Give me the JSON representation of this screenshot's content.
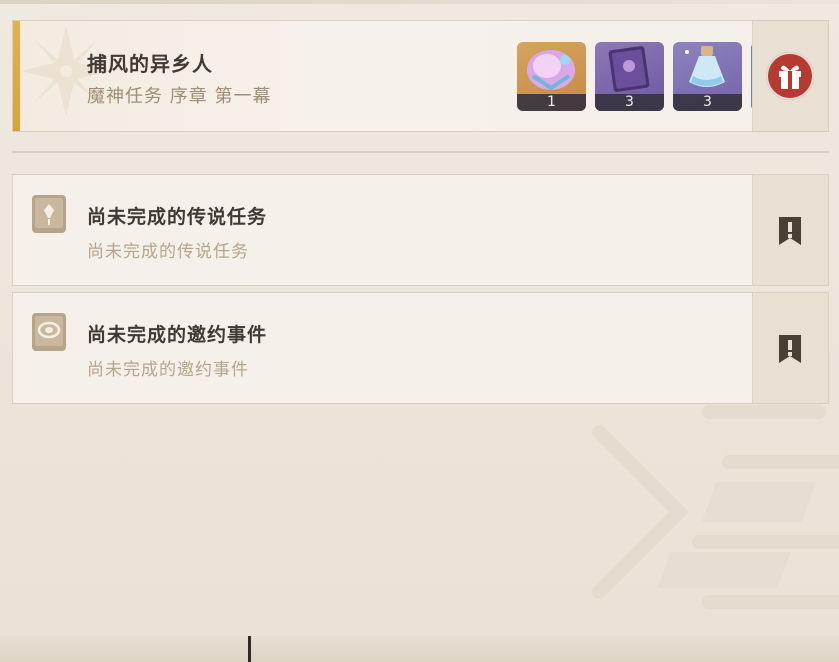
{
  "main_quest": {
    "title": "捕风的异乡人",
    "subtitle": "魔神任务 序章 第一幕",
    "accent_color": "#e2b14a",
    "rewards": [
      {
        "icon": "crystal-gem-icon",
        "count": "1"
      },
      {
        "icon": "purple-book-icon",
        "count": "3"
      },
      {
        "icon": "potion-bottle-icon",
        "count": "3"
      }
    ],
    "claim_icon": "gift-icon"
  },
  "list_items": [
    {
      "icon": "legend-book-icon",
      "title": "尚未完成的传说任务",
      "subtitle": "尚未完成的传说任务",
      "side_icon": "flag-exclamation-icon"
    },
    {
      "icon": "hangout-book-icon",
      "title": "尚未完成的邀约事件",
      "subtitle": "尚未完成的邀约事件",
      "side_icon": "flag-exclamation-icon"
    }
  ],
  "colors": {
    "gift_red": "#b63a32",
    "text_dark": "#3f3a34",
    "text_muted": "#a18d76"
  }
}
